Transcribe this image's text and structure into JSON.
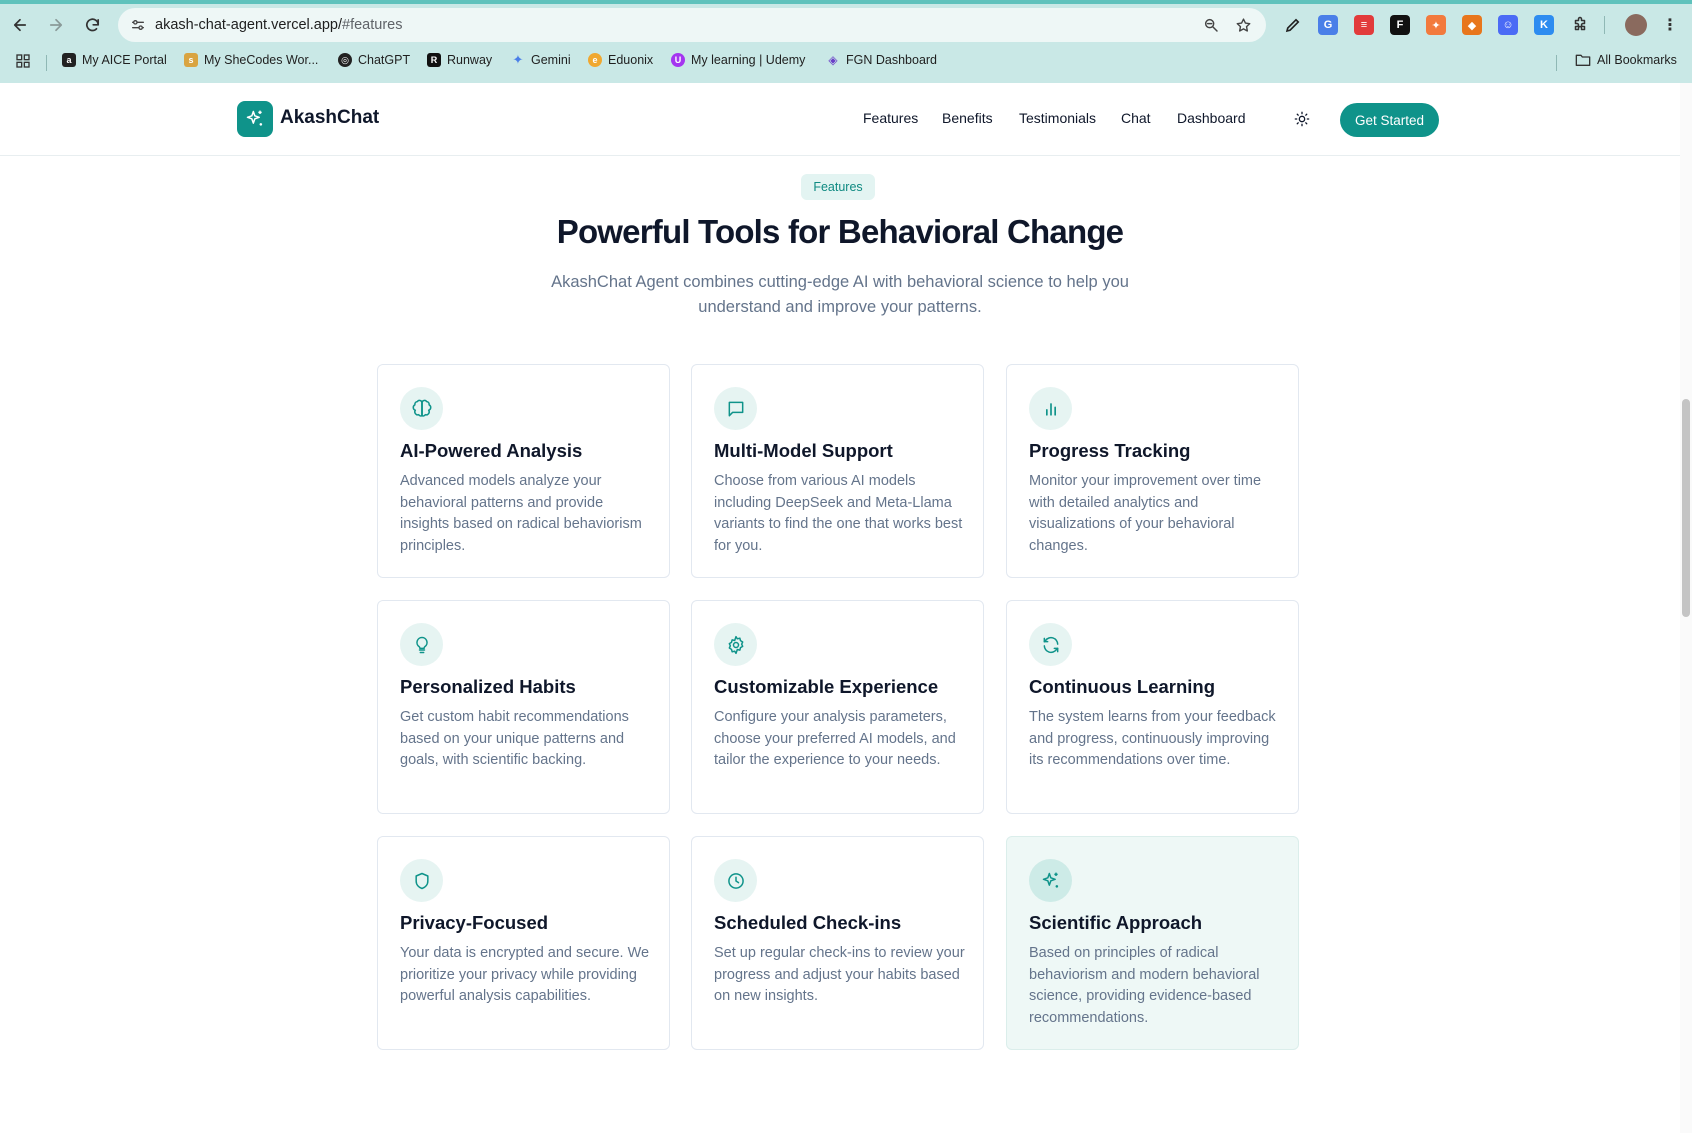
{
  "browser": {
    "url_domain": "akash-chat-agent.vercel.app/",
    "url_path": "#features",
    "bookmarks": [
      {
        "label": "My AICE Portal"
      },
      {
        "label": "My SheCodes Wor..."
      },
      {
        "label": "ChatGPT"
      },
      {
        "label": "Runway"
      },
      {
        "label": "Gemini"
      },
      {
        "label": "Eduonix"
      },
      {
        "label": "My learning | Udemy"
      },
      {
        "label": "FGN Dashboard"
      }
    ],
    "all_bookmarks_label": "All Bookmarks"
  },
  "header": {
    "logo_text": "AkashChat",
    "nav": [
      "Features",
      "Benefits",
      "Testimonials",
      "Chat",
      "Dashboard"
    ],
    "cta_label": "Get Started"
  },
  "section": {
    "badge": "Features",
    "title": "Powerful Tools for Behavioral Change",
    "subtitle": "AkashChat Agent combines cutting-edge AI with behavioral science to help you understand and improve your patterns."
  },
  "features": [
    {
      "icon": "brain-icon",
      "title": "AI-Powered Analysis",
      "description": "Advanced models analyze your behavioral patterns and provide insights based on radical behaviorism principles."
    },
    {
      "icon": "message-icon",
      "title": "Multi-Model Support",
      "description": "Choose from various AI models including DeepSeek and Meta-Llama variants to find the one that works best for you."
    },
    {
      "icon": "bar-chart-icon",
      "title": "Progress Tracking",
      "description": "Monitor your improvement over time with detailed analytics and visualizations of your behavioral changes."
    },
    {
      "icon": "lightbulb-icon",
      "title": "Personalized Habits",
      "description": "Get custom habit recommendations based on your unique patterns and goals, with scientific backing."
    },
    {
      "icon": "gear-icon",
      "title": "Customizable Experience",
      "description": "Configure your analysis parameters, choose your preferred AI models, and tailor the experience to your needs."
    },
    {
      "icon": "refresh-icon",
      "title": "Continuous Learning",
      "description": "The system learns from your feedback and progress, continuously improving its recommendations over time."
    },
    {
      "icon": "shield-icon",
      "title": "Privacy-Focused",
      "description": "Your data is encrypted and secure. We prioritize your privacy while providing powerful analysis capabilities."
    },
    {
      "icon": "clock-icon",
      "title": "Scheduled Check-ins",
      "description": "Set up regular check-ins to review your progress and adjust your habits based on new insights."
    },
    {
      "icon": "sparkles-icon",
      "title": "Scientific Approach",
      "description": "Based on principles of radical behaviorism and modern behavioral science, providing evidence-based recommendations."
    }
  ],
  "colors": {
    "brand": "#0f938a",
    "brand_light": "#e6f4f2",
    "highlight_card": "#eef8f6",
    "chrome": "#c9e8e6"
  }
}
